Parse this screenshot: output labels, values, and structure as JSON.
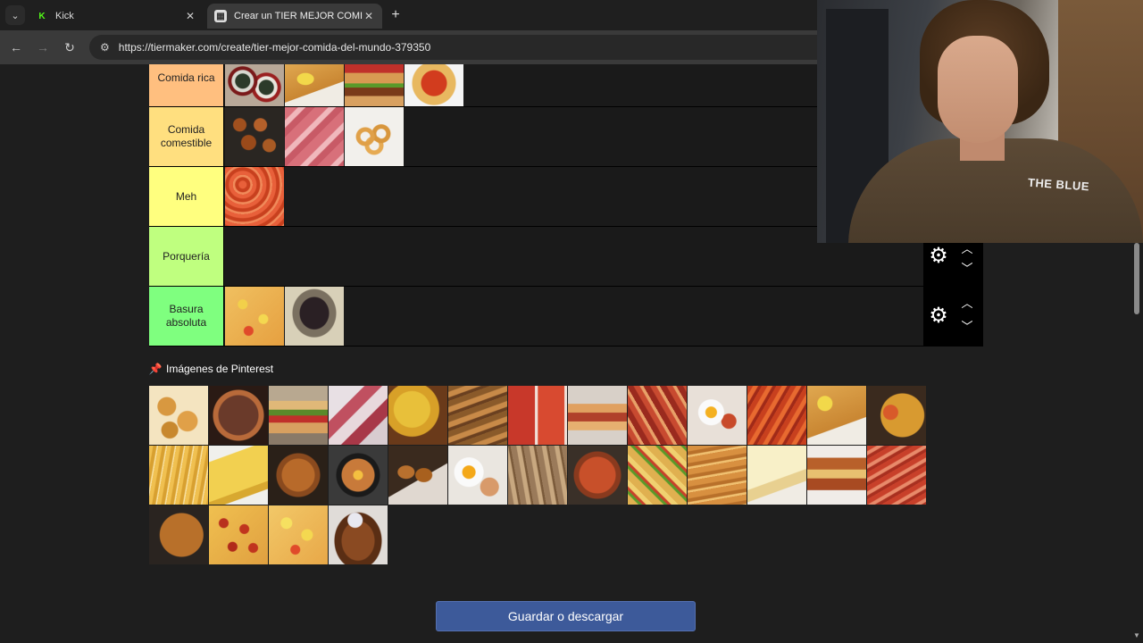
{
  "browser": {
    "tabs": [
      {
        "title": "Kick",
        "active": false
      },
      {
        "title": "Crear un TIER MEJOR COMIDA",
        "active": true
      }
    ],
    "url": "https://tiermaker.com/create/tier-mejor-comida-del-mundo-379350"
  },
  "tiers": [
    {
      "label": "Comida rica",
      "color": "#ffbf7f",
      "items": [
        "sushi",
        "tonkatsu",
        "burger",
        "spaghetti"
      ]
    },
    {
      "label": "Comida comestible",
      "color": "#ffdf7f",
      "items": [
        "meatballs",
        "jamon",
        "calamari"
      ]
    },
    {
      "label": "Meh",
      "color": "#ffff7f",
      "items": [
        "prawns"
      ]
    },
    {
      "label": "Porquería",
      "color": "#bfff7f",
      "items": []
    },
    {
      "label": "Basura absoluta",
      "color": "#7fff7f",
      "items": [
        "hawaiian-pizza",
        "bat-soup"
      ]
    }
  ],
  "pool": {
    "title": "Imágenes de Pinterest",
    "items": [
      "nuggets",
      "meatball-bowl",
      "sandwich",
      "jelly-shots",
      "paella",
      "grilled-fish",
      "gazpacho",
      "hot-dog",
      "sausages",
      "eggs-plate",
      "pasta-tomato",
      "schnitzel",
      "seafood-paella",
      "fries",
      "tortilla",
      "roast-chicken",
      "ramen",
      "croquetas",
      "fried-egg",
      "sardines",
      "soup",
      "tacos",
      "churros",
      "cheesecake",
      "lasagna",
      "bacon",
      "rice",
      "pepperoni-pizza",
      "hawaiian-pizza-2",
      "chicken-wings"
    ]
  },
  "save_button": "Guardar o descargar",
  "webcam": {
    "shirt_text": "THE BLUE"
  },
  "colors": {
    "save_button": "#3d5a9a",
    "page_bg": "#1e1e1e"
  }
}
